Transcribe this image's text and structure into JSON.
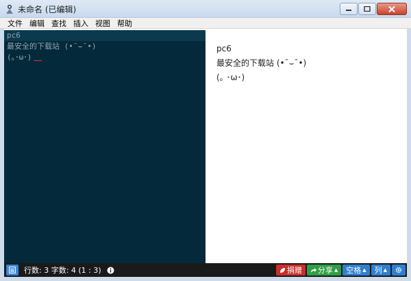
{
  "window": {
    "title": "未命名 (已编辑)",
    "buttons": {
      "minimize": "minimize-icon",
      "maximize": "maximize-icon",
      "close": "close-icon"
    }
  },
  "menu": {
    "items": [
      "文件",
      "编辑",
      "查找",
      "插入",
      "视图",
      "帮助"
    ]
  },
  "editor": {
    "lines": [
      "pc6",
      "最安全的下载站 (•ˉ⌣ˉ•)",
      "(｡･ω･)"
    ]
  },
  "preview": {
    "lines": [
      "pc6",
      "最安全的下载站 (•ˉ⌣ˉ•)",
      "(｡ ･ω･)"
    ]
  },
  "status": {
    "stats": "行数: 3   字数: 4   (1 : 3)",
    "info_icon": "info-icon",
    "donate_label": "捐赠",
    "share_label": "分享",
    "spaces_label": "空格",
    "column_label": "列"
  },
  "colors": {
    "editor_bg": "#04293a",
    "statusbar_bg": "#1a1a1a",
    "donate": "#c9302c",
    "share": "#2f9e44",
    "blue": "#2f7fd1"
  }
}
